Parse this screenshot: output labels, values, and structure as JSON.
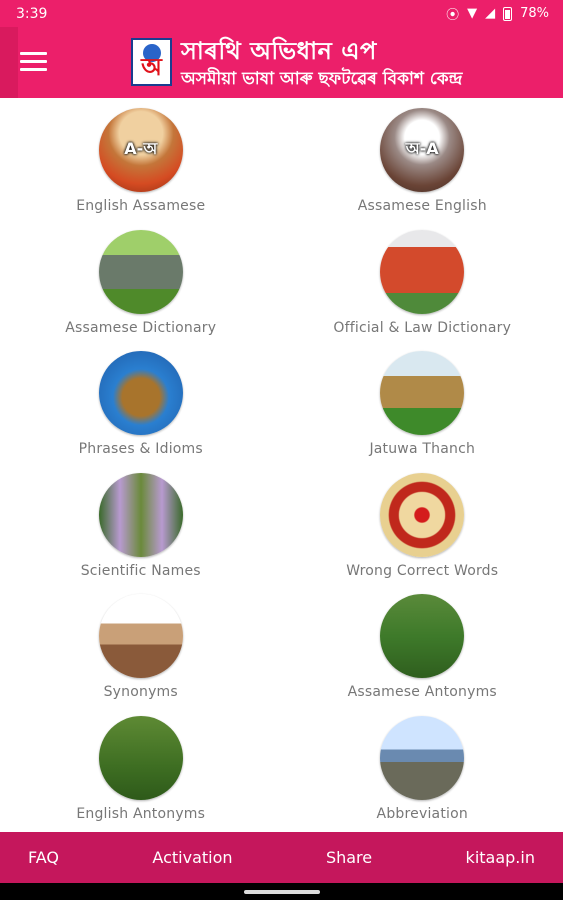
{
  "status_bar": {
    "time": "3:39",
    "battery": "78%"
  },
  "app_bar": {
    "title": "সাৰথি অভিধান এপ",
    "subtitle": "অসমীয়া ভাষা আৰু ছফটৱেৰ বিকাশ কেন্দ্ৰ",
    "logo_letter": "অ"
  },
  "menu": [
    {
      "label": "English Assamese",
      "image_caption": "A-অ",
      "icon": "english-assamese-icon"
    },
    {
      "label": "Assamese English",
      "image_caption": "অ-A",
      "icon": "assamese-english-icon"
    },
    {
      "label": "Assamese Dictionary",
      "image_caption": "",
      "icon": "assamese-dictionary-icon"
    },
    {
      "label": "Official & Law Dictionary",
      "image_caption": "",
      "icon": "official-law-dictionary-icon"
    },
    {
      "label": "Phrases & Idioms",
      "image_caption": "",
      "icon": "phrases-idioms-icon"
    },
    {
      "label": "Jatuwa Thanch",
      "image_caption": "",
      "icon": "jatuwa-thanch-icon"
    },
    {
      "label": "Scientific Names",
      "image_caption": "",
      "icon": "scientific-names-icon"
    },
    {
      "label": "Wrong Correct Words",
      "image_caption": "",
      "icon": "wrong-correct-words-icon"
    },
    {
      "label": "Synonyms",
      "image_caption": "",
      "icon": "synonyms-icon"
    },
    {
      "label": "Assamese Antonyms",
      "image_caption": "",
      "icon": "assamese-antonyms-icon"
    },
    {
      "label": "English Antonyms",
      "image_caption": "",
      "icon": "english-antonyms-icon"
    },
    {
      "label": "Abbreviation",
      "image_caption": "",
      "icon": "abbreviation-icon"
    }
  ],
  "bottom_nav": {
    "faq": "FAQ",
    "activation": "Activation",
    "share": "Share",
    "website": "kitaap.in"
  },
  "colors": {
    "primary": "#ec1f6a",
    "bottom_bar": "#c5175c",
    "label_gray": "#777777"
  }
}
